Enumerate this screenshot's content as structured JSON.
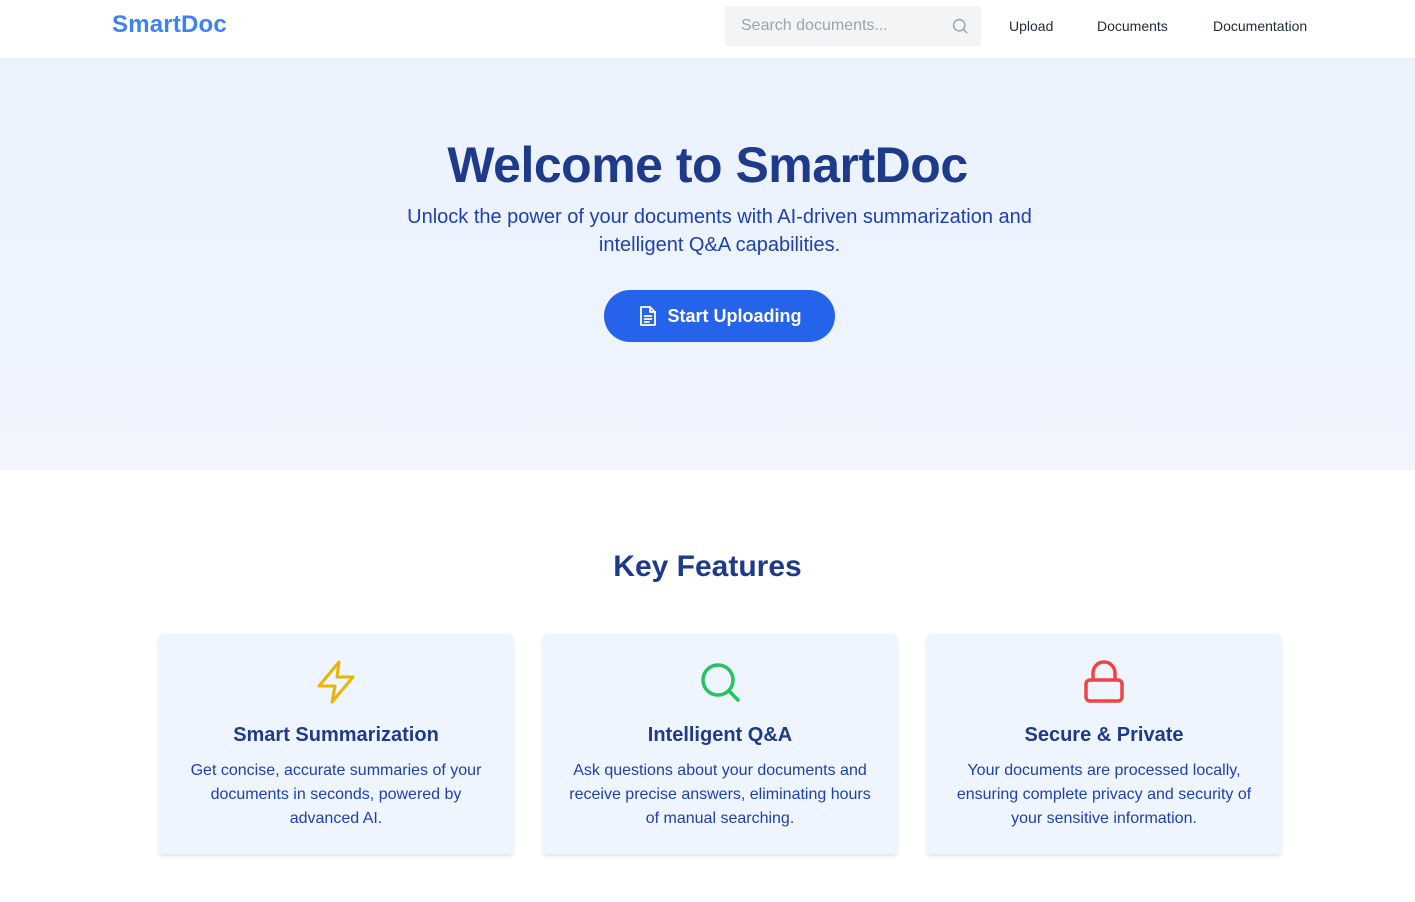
{
  "header": {
    "logo": "SmartDoc",
    "search": {
      "placeholder": "Search documents...",
      "icon": "search-icon"
    },
    "nav": [
      {
        "label": "Upload"
      },
      {
        "label": "Documents"
      },
      {
        "label": "Documentation"
      }
    ]
  },
  "hero": {
    "title": "Welcome to SmartDoc",
    "subtitle": "Unlock the power of your documents with AI-driven summarization and intelligent Q&A capabilities.",
    "cta": {
      "label": "Start Uploading",
      "icon": "document-icon"
    }
  },
  "features": {
    "title": "Key Features",
    "items": [
      {
        "icon": "lightning-icon",
        "title": "Smart Summarization",
        "text": "Get concise, accurate summaries of your documents in seconds, powered by advanced AI.",
        "color": "#eab308"
      },
      {
        "icon": "magnifier-icon",
        "title": "Intelligent Q&A",
        "text": "Ask questions about your documents and receive precise answers, eliminating hours of manual searching.",
        "color": "#22c55e"
      },
      {
        "icon": "lock-icon",
        "title": "Secure & Private",
        "text": "Your documents are processed locally, ensuring complete privacy and security of your sensitive information.",
        "color": "#ef4444"
      }
    ]
  },
  "colors": {
    "brand": "#3b82f6",
    "primary_button": "#2563eb",
    "heading": "#1e3a8a",
    "hero_background": "#eaf2fe"
  }
}
